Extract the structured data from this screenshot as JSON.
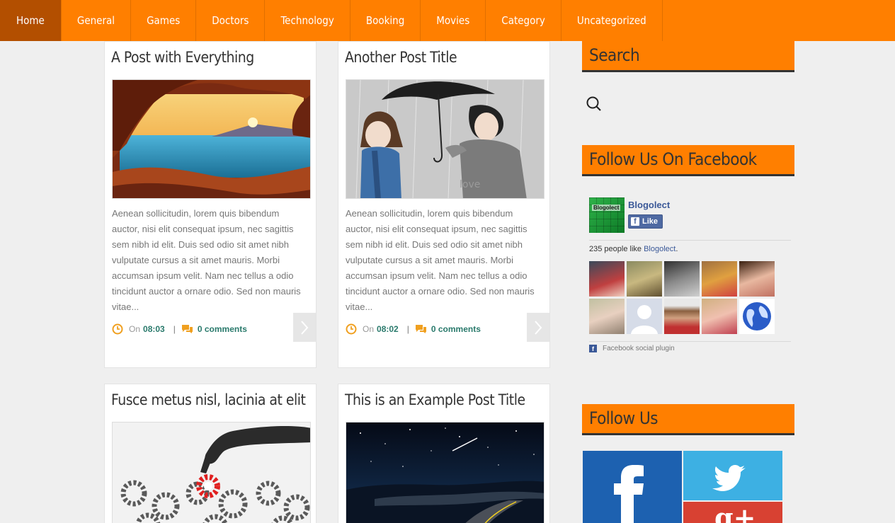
{
  "nav": {
    "items": [
      {
        "label": "Home",
        "active": true
      },
      {
        "label": "General"
      },
      {
        "label": "Games"
      },
      {
        "label": "Doctors"
      },
      {
        "label": "Technology"
      },
      {
        "label": "Booking"
      },
      {
        "label": "Movies"
      },
      {
        "label": "Category"
      },
      {
        "label": "Uncategorized"
      }
    ]
  },
  "posts": [
    {
      "title": "A Post with Everything",
      "excerpt": "Aenean sollicitudin, lorem quis bibendum auctor, nisi elit consequat ipsum, nec sagittis sem nibh id elit. Duis sed odio sit amet nibh vulputate cursus a sit amet mauris. Morbi accumsan ipsum velit. Nam nec tellus a odio tincidunt auctor a ornare odio. Sed non mauris vitae...",
      "on_label": "On",
      "time": "08:03",
      "separator": "|",
      "comments": "0 comments"
    },
    {
      "title": "Another Post Title",
      "excerpt": "Aenean sollicitudin, lorem quis bibendum auctor, nisi elit consequat ipsum, nec sagittis sem nibh id elit. Duis sed odio sit amet nibh vulputate cursus a sit amet mauris. Morbi accumsan ipsum velit. Nam nec tellus a odio tincidunt auctor a ornare odio. Sed non mauris vitae...",
      "on_label": "On",
      "time": "08:02",
      "separator": "|",
      "comments": "0 comments"
    },
    {
      "title": "Fusce metus nisl, lacinia at elit"
    },
    {
      "title": "This is an Example Post Title"
    }
  ],
  "sidebar": {
    "search_title": "Search",
    "facebook_title": "Follow Us On Facebook",
    "follow_title": "Follow Us",
    "facebook": {
      "page_name": "Blogolect",
      "logo_text": "Blogolect",
      "like_label": "Like",
      "like_count_text": "235 people like",
      "like_count_link": "Blogolect",
      "like_count_suffix": ".",
      "plugin_label": "Facebook social plugin",
      "fb_glyph": "f"
    },
    "social": {
      "facebook_glyph": "f",
      "google_glyph": "g+"
    }
  },
  "colors": {
    "accent": "#ff7f00",
    "nav_active": "#b34f00",
    "facebook": "#1d61b0",
    "twitter": "#3db0e3",
    "google": "#d84132",
    "meta_link": "#2a7a6c"
  }
}
